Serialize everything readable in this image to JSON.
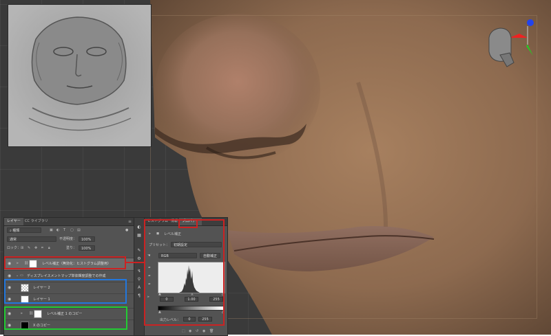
{
  "layers_panel": {
    "tabs": [
      "レイヤー",
      "CC ライブラリ"
    ],
    "filter_kind": "種類",
    "blend_mode": "通常",
    "opacity_label": "不透明度：",
    "opacity_value": "100%",
    "lock_label": "ロック：",
    "fill_label": "塗り：",
    "fill_value": "100%",
    "layers": [
      {
        "name": "レベル補正（無効化：ヒストグラム調整用）",
        "type": "adjustment",
        "highlight": "#cc2222"
      },
      {
        "name": "ディスプレイスメントマップ単体輝度調整での作成",
        "type": "group"
      },
      {
        "name": "レイヤー 2",
        "type": "pixel",
        "highlight": "#2277dd"
      },
      {
        "name": "レイヤー 1",
        "type": "pixel",
        "highlight": "#2277dd"
      },
      {
        "name": "レベル補正 1 のコピー",
        "type": "adjustment",
        "highlight": "#22cc33"
      },
      {
        "name": "X のコピー",
        "type": "pixel",
        "highlight": "#22cc33"
      }
    ]
  },
  "properties_panel": {
    "tabs": [
      "ヒストグラム",
      "情報",
      "プロパティ"
    ],
    "title": "レベル補正",
    "preset_label": "プリセット：",
    "preset_value": "初期設定",
    "channel": "RGB",
    "auto_button": "自動補正",
    "input_black": "0",
    "input_gamma": "1.00",
    "input_white": "255",
    "output_label": "出力レベル：",
    "output_black": "0",
    "output_white": "255",
    "highlight": "#cc2222"
  },
  "colors": {
    "panel_bg": "#535353",
    "callout_red": "#cc2222",
    "callout_blue": "#2277dd",
    "callout_green": "#22cc33"
  }
}
